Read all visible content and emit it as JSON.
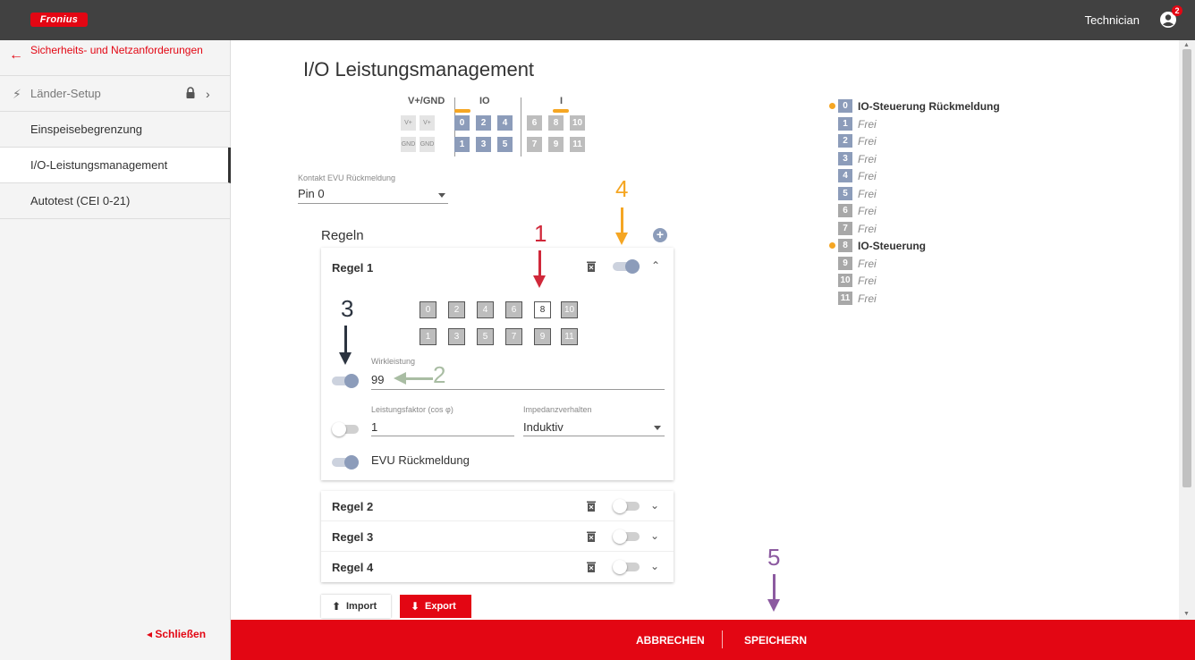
{
  "topbar": {
    "logo_text": "Fronius",
    "user_name": "Technician",
    "notification_count": "2"
  },
  "sidebar": {
    "back_label": "Sicherheits- und Netzanforderungen",
    "items": [
      {
        "label": "Länder-Setup",
        "locked": true
      },
      {
        "label": "Einspeisebegrenzung"
      },
      {
        "label": "I/O-Leistungsmanagement",
        "active": true
      },
      {
        "label": "Autotest (CEI 0-21)"
      }
    ],
    "close_label": "◂ Schließen"
  },
  "main": {
    "title": "I/O Leistungsmanagement",
    "pinmap": {
      "group_vgnd": "V+/GND",
      "group_io": "IO",
      "group_i": "I",
      "vplus": "V+",
      "gnd": "GND",
      "top_pins": [
        "0",
        "2",
        "4",
        "6",
        "8",
        "10"
      ],
      "bottom_pins": [
        "1",
        "3",
        "5",
        "7",
        "9",
        "11"
      ]
    },
    "contact": {
      "label": "Kontakt EVU Rückmeldung",
      "value": "Pin 0"
    },
    "rules_title": "Regeln",
    "rules": [
      {
        "title": "Regel 1",
        "enabled": true,
        "expanded": true,
        "pins_top": [
          "0",
          "2",
          "4",
          "6",
          "8",
          "10"
        ],
        "pins_bottom": [
          "1",
          "3",
          "5",
          "7",
          "9",
          "11"
        ],
        "selected_pin": "8",
        "wirkleistung": {
          "label": "Wirkleistung",
          "value": "99",
          "enabled": true
        },
        "leistungsfaktor": {
          "label": "Leistungsfaktor (cos φ)",
          "value": "1",
          "enabled": false
        },
        "impedanz": {
          "label": "Impedanzverhalten",
          "value": "Induktiv"
        },
        "evu": {
          "label": "EVU Rückmeldung",
          "enabled": true
        }
      },
      {
        "title": "Regel 2",
        "enabled": false
      },
      {
        "title": "Regel 3",
        "enabled": false
      },
      {
        "title": "Regel 4",
        "enabled": false
      }
    ],
    "import_label": "Import",
    "export_label": "Export"
  },
  "legend": [
    {
      "pin": "0",
      "text": "IO-Steuerung Rückmeldung",
      "used": true
    },
    {
      "pin": "1",
      "text": "Frei"
    },
    {
      "pin": "2",
      "text": "Frei"
    },
    {
      "pin": "3",
      "text": "Frei"
    },
    {
      "pin": "4",
      "text": "Frei"
    },
    {
      "pin": "5",
      "text": "Frei"
    },
    {
      "pin": "6",
      "text": "Frei"
    },
    {
      "pin": "7",
      "text": "Frei"
    },
    {
      "pin": "8",
      "text": "IO-Steuerung",
      "used": true
    },
    {
      "pin": "9",
      "text": "Frei"
    },
    {
      "pin": "10",
      "text": "Frei"
    },
    {
      "pin": "11",
      "text": "Frei"
    }
  ],
  "annotations": {
    "n1": "1",
    "n2": "2",
    "n3": "3",
    "n4": "4",
    "n5": "5",
    "colors": {
      "n1": "#d0283a",
      "n2": "#a9bda3",
      "n3": "#2c3440",
      "n4": "#f5a623",
      "n5": "#8c5aa0"
    }
  },
  "footer": {
    "cancel": "ABBRECHEN",
    "save": "SPEICHERN"
  },
  "colors": {
    "brand_red": "#e30613",
    "pin_blue": "#8c9cba",
    "accent_orange": "#f5a623"
  }
}
